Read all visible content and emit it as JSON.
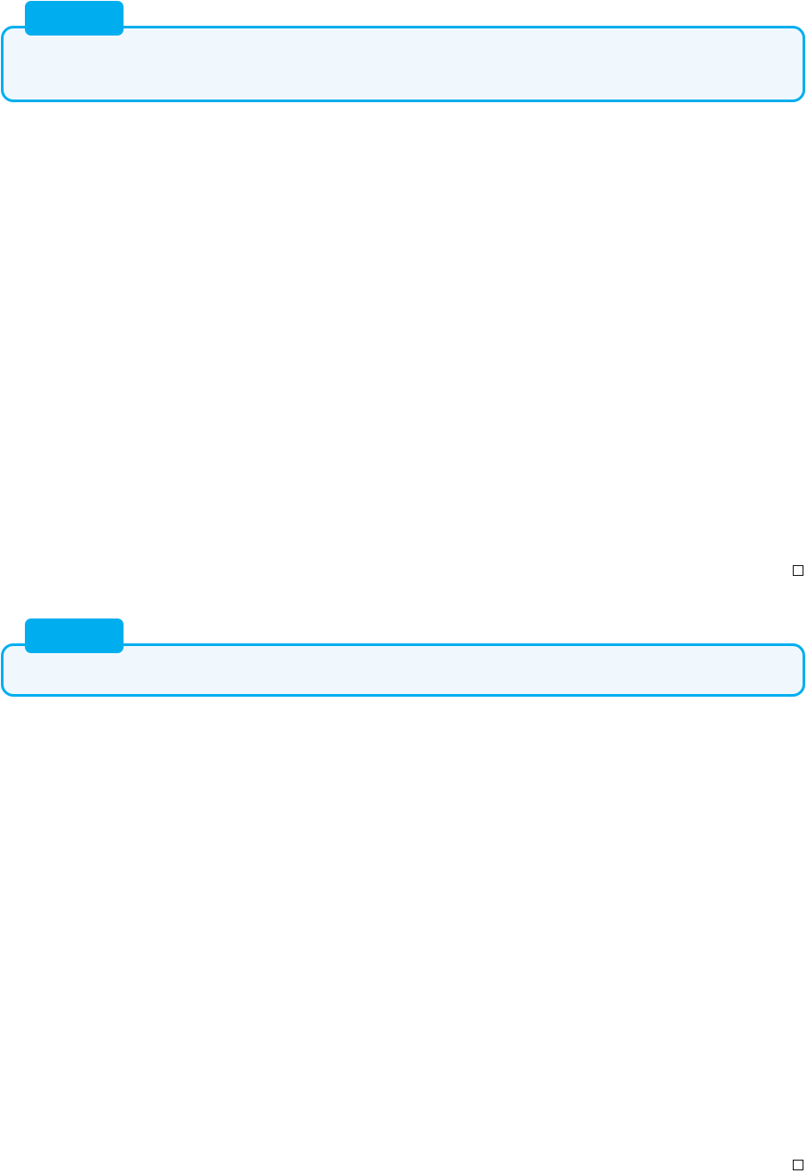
{
  "sections": [
    {
      "tab_label": "",
      "body_text": ""
    },
    {
      "tab_label": "",
      "body_text": ""
    }
  ],
  "colors": {
    "accent": "#00aeef",
    "card_background": "#f0f8fe",
    "end_mark_border": "#111111"
  },
  "icons": [
    "end-of-section-square-icon"
  ]
}
